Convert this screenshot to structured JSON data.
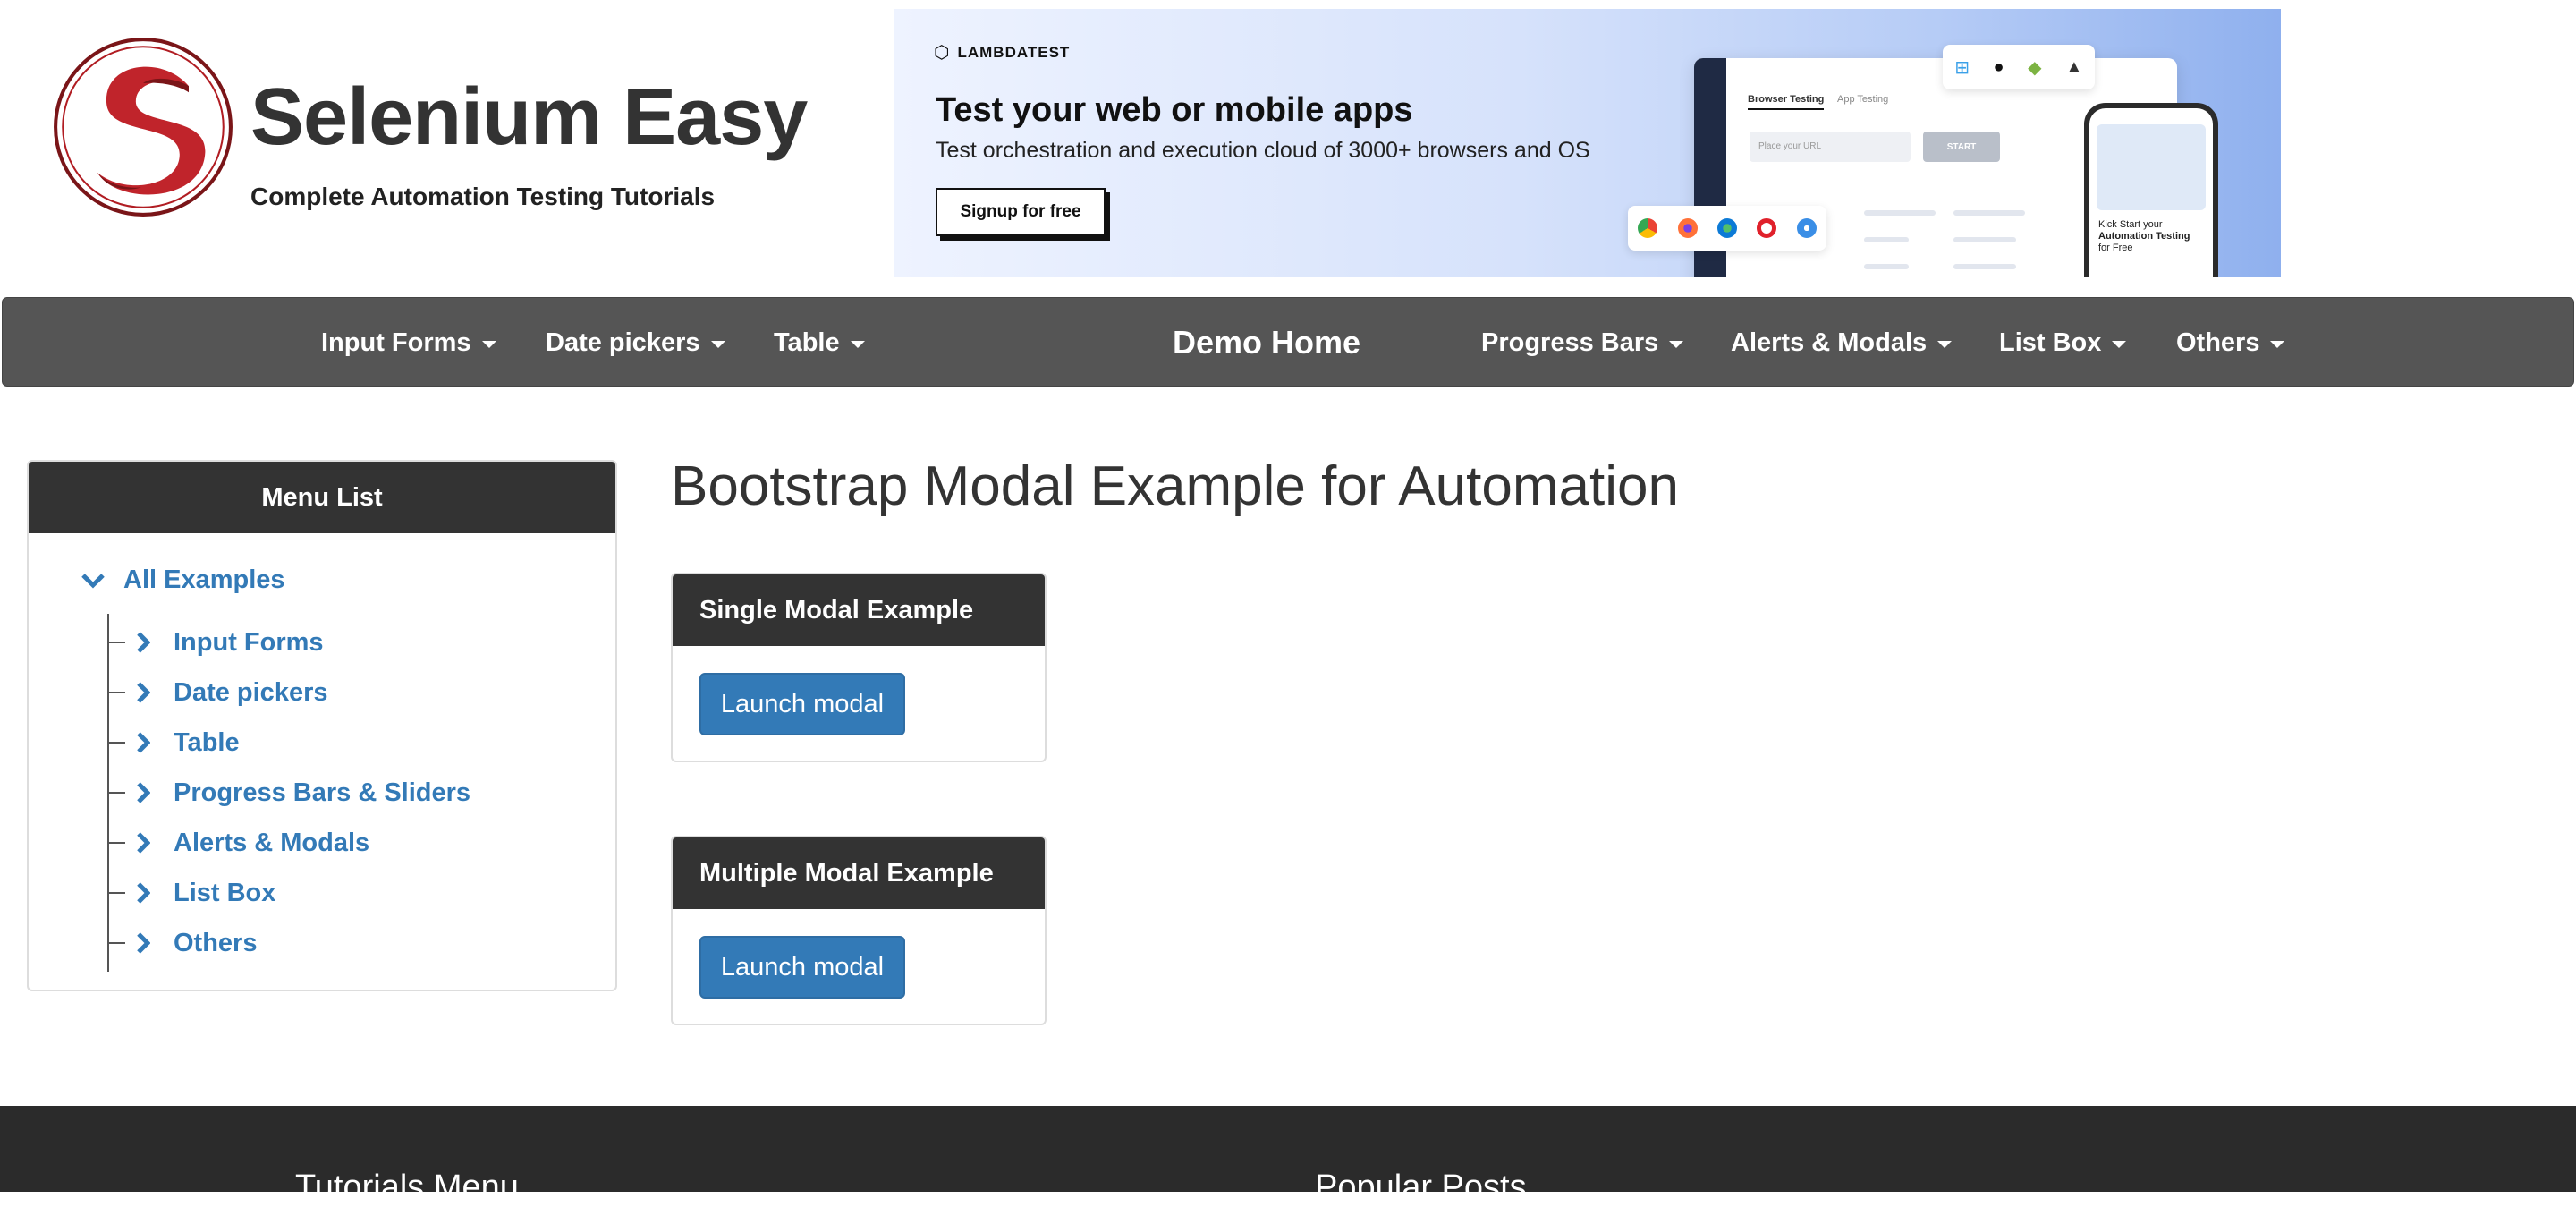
{
  "site": {
    "title": "Selenium Easy",
    "tagline": "Complete Automation Testing Tutorials"
  },
  "banner": {
    "brand": "LAMBDATEST",
    "headline": "Test your web or mobile apps",
    "subtext": "Test orchestration and execution cloud of 3000+ browsers and OS",
    "cta": "Signup for free",
    "mock_tab_active": "Browser Testing",
    "mock_tab_second": "App Testing",
    "mock_url_placeholder": "Place your URL",
    "mock_start": "START",
    "phone_line1": "Kick Start your",
    "phone_line2": "Automation Testing",
    "phone_line3": "for Free"
  },
  "nav": {
    "input_forms": "Input Forms",
    "date_pickers": "Date pickers",
    "table": "Table",
    "demo_home": "Demo Home",
    "progress_bars": "Progress Bars",
    "alerts_modals": "Alerts & Modals",
    "list_box": "List Box",
    "others": "Others"
  },
  "sidebar": {
    "heading": "Menu List",
    "root": "All Examples",
    "items": [
      {
        "label": "Input Forms"
      },
      {
        "label": "Date pickers"
      },
      {
        "label": "Table"
      },
      {
        "label": "Progress Bars & Sliders"
      },
      {
        "label": "Alerts & Modals"
      },
      {
        "label": "List Box"
      },
      {
        "label": "Others"
      }
    ]
  },
  "main": {
    "title": "Bootstrap Modal Example for Automation",
    "panels": [
      {
        "heading": "Single Modal Example",
        "button": "Launch modal"
      },
      {
        "heading": "Multiple Modal Example",
        "button": "Launch modal"
      }
    ]
  },
  "footer": {
    "tutorials_menu": "Tutorials Menu",
    "popular_posts": "Popular Posts"
  },
  "colors": {
    "nav_bg": "#555555",
    "panel_head_bg": "#333333",
    "link": "#337ab7",
    "button": "#337ab7",
    "footer_bg": "#2b2b2b",
    "logo_red": "#c0242b"
  }
}
